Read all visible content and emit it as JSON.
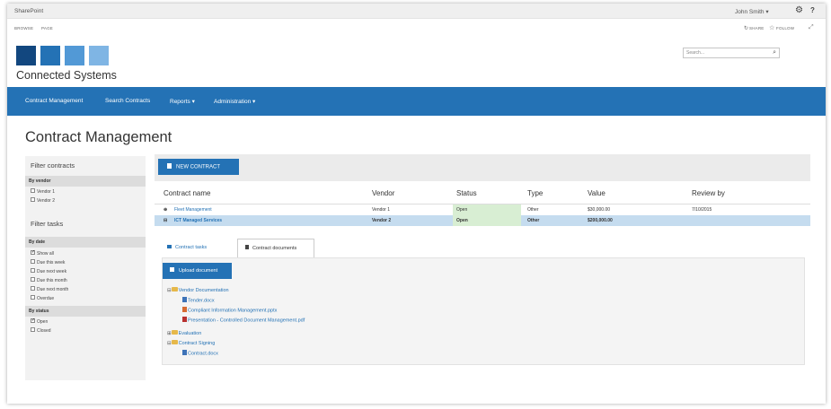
{
  "suite_bar": {
    "brand": "SharePoint",
    "user": "John Smith ▾",
    "settings_icon": "gear-icon",
    "help_icon": "help-icon",
    "help_label": "?"
  },
  "ribbon": {
    "tabs": [
      "BROWSE",
      "PAGE"
    ],
    "share": "SHARE",
    "follow": "FOLLOW",
    "share_icon": "share-icon",
    "follow_icon": "star-icon",
    "focus_icon": "focus-icon"
  },
  "site": {
    "logo_colors": [
      "#12477f",
      "#2472b5",
      "#5299d6",
      "#7fb5e4"
    ],
    "name": "Connected Systems"
  },
  "search": {
    "placeholder": "Search...",
    "icon": "search-icon"
  },
  "topnav": {
    "items": [
      "Contract Management",
      "Search Contracts",
      "Reports ▾",
      "Administration ▾"
    ]
  },
  "page": {
    "title": "Contract Management"
  },
  "filters": {
    "contracts_heading": "Filter contracts",
    "by_vendor": "By vendor",
    "vendors": [
      {
        "label": "Vendor 1",
        "checked": false
      },
      {
        "label": "Vendor 2",
        "checked": false
      }
    ],
    "tasks_heading": "Filter tasks",
    "by_date": "By date",
    "dates": [
      {
        "label": "Show all",
        "checked": true
      },
      {
        "label": "Due this week",
        "checked": false
      },
      {
        "label": "Due next week",
        "checked": false
      },
      {
        "label": "Due this month",
        "checked": false
      },
      {
        "label": "Due next month",
        "checked": false
      },
      {
        "label": "Overdue",
        "checked": false
      }
    ],
    "by_status": "By status",
    "statuses": [
      {
        "label": "Open",
        "checked": true
      },
      {
        "label": "Closed",
        "checked": false
      }
    ]
  },
  "toolbar": {
    "new_contract": "NEW CONTRACT",
    "new_contract_icon": "document-icon"
  },
  "table": {
    "headers": [
      "Contract name",
      "Vendor",
      "Status",
      "Type",
      "Value",
      "Review by"
    ],
    "rows": [
      {
        "expand": "⊕",
        "name": "Fleet Management",
        "vendor": "Vendor 1",
        "status": "Open",
        "type": "Other",
        "value": "$30,000.00",
        "review": "7/10/2015",
        "selected": false
      },
      {
        "expand": "⊟",
        "name": "ICT Managed Services",
        "vendor": "Vendor 2",
        "status": "Open",
        "type": "Other",
        "value": "$200,000.00",
        "review": "",
        "selected": true
      }
    ]
  },
  "detail_tabs": {
    "items": [
      "Contract tasks",
      "Contract documents"
    ],
    "active": "Contract documents"
  },
  "documents": {
    "upload_label": "Upload document",
    "upload_icon": "upload-icon",
    "tree": {
      "vendor_docs": "Vendor Documentation",
      "tender": "Tender.docx",
      "compliant": "Compliant Information Management.pptx",
      "presentation": "Presentation - Controlled Document Management.pdf",
      "evaluation": "Evaluation",
      "signing": "Contract Signing",
      "contract": "Contract.docx"
    }
  }
}
